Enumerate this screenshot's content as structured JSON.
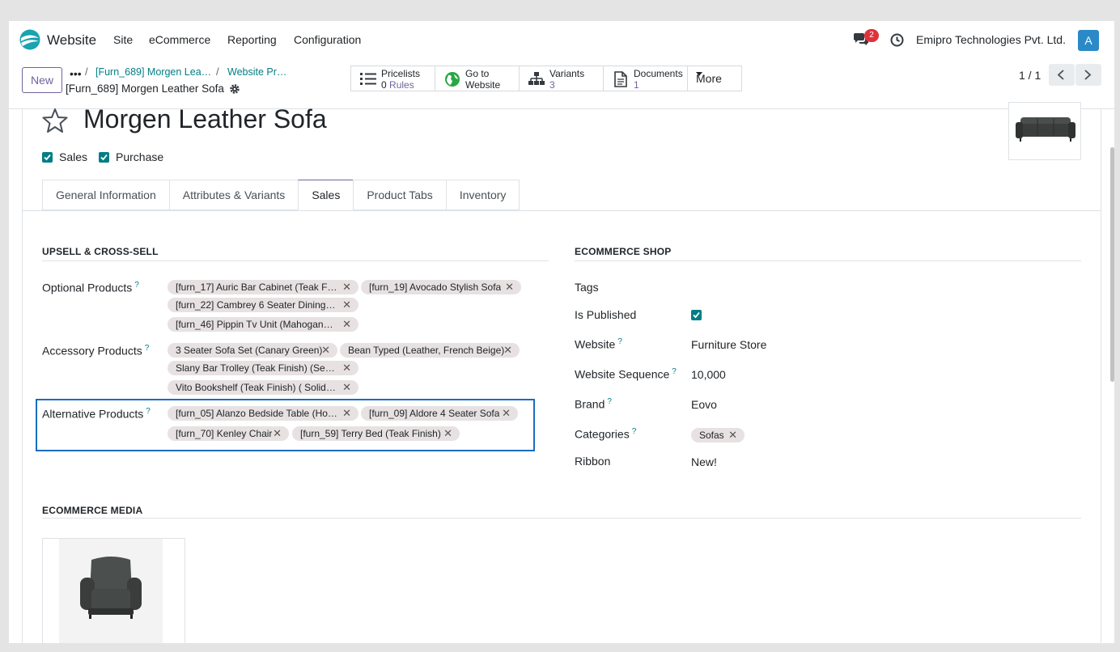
{
  "nav": {
    "app_name": "Website",
    "menu": [
      "Site",
      "eCommerce",
      "Reporting",
      "Configuration"
    ],
    "chat_count": "2",
    "company": "Emipro Technologies Pvt. Ltd.",
    "avatar_letter": "A"
  },
  "control": {
    "new_label": "New",
    "breadcrumb": [
      "[Furn_689] Morgen Lea…",
      "Website Pr…"
    ],
    "current": "[Furn_689] Morgen Leather Sofa",
    "smart_buttons": [
      {
        "title": "Pricelists",
        "count": "0",
        "sub": "Rules",
        "icon": "list-icon"
      },
      {
        "title": "Go to",
        "sub": "Website",
        "icon": "globe-icon"
      },
      {
        "title": "Variants",
        "count": "3",
        "icon": "sitemap-icon"
      },
      {
        "title": "Documents",
        "count": "1",
        "icon": "document-icon"
      }
    ],
    "more_label": "More",
    "pager": "1 / 1"
  },
  "product": {
    "name": "Morgen Leather Sofa",
    "checkboxes": [
      {
        "label": "Sales",
        "checked": true
      },
      {
        "label": "Purchase",
        "checked": true
      }
    ]
  },
  "tabs": [
    "General Information",
    "Attributes & Variants",
    "Sales",
    "Product Tabs",
    "Inventory"
  ],
  "active_tab": "Sales",
  "upsell": {
    "title": "UPSELL & CROSS-SELL",
    "optional_label": "Optional Products",
    "optional": [
      "[furn_17] Auric Bar Cabinet (Teak Fi…",
      "[furn_19] Avocado Stylish Sofa",
      "[furn_22] Cambrey 6 Seater Dining S…",
      "[furn_46] Pippin Tv Unit (Mahogany …"
    ],
    "accessory_label": "Accessory Products",
    "accessory": [
      "3 Seater Sofa Set (Canary Green)",
      "Bean Typed (Leather, French Beige)",
      "Slany Bar Trolley (Teak Finish) (Sea …",
      "Vito Bookshelf (Teak Finish) ( Solid …"
    ],
    "alternative_label": "Alternative Products",
    "alternative": [
      "[furn_05] Alanzo Bedside Table (Hon…",
      "[furn_09] Aldore 4 Seater Sofa",
      "[furn_70] Kenley Chair",
      "[furn_59] Terry Bed (Teak Finish)"
    ]
  },
  "shop": {
    "title": "ECOMMERCE SHOP",
    "tags_label": "Tags",
    "published_label": "Is Published",
    "is_published": true,
    "website_label": "Website",
    "website": "Furniture Store",
    "sequence_label": "Website Sequence",
    "sequence": "10,000",
    "brand_label": "Brand",
    "brand": "Eovo",
    "categories_label": "Categories",
    "categories": [
      "Sofas"
    ],
    "ribbon_label": "Ribbon",
    "ribbon": "New!"
  },
  "media": {
    "title": "ECOMMERCE MEDIA"
  },
  "colors": {
    "accent": "#71639e",
    "link": "#017e84",
    "highlight": "#1a6dbf",
    "badge": "#e0323b"
  }
}
